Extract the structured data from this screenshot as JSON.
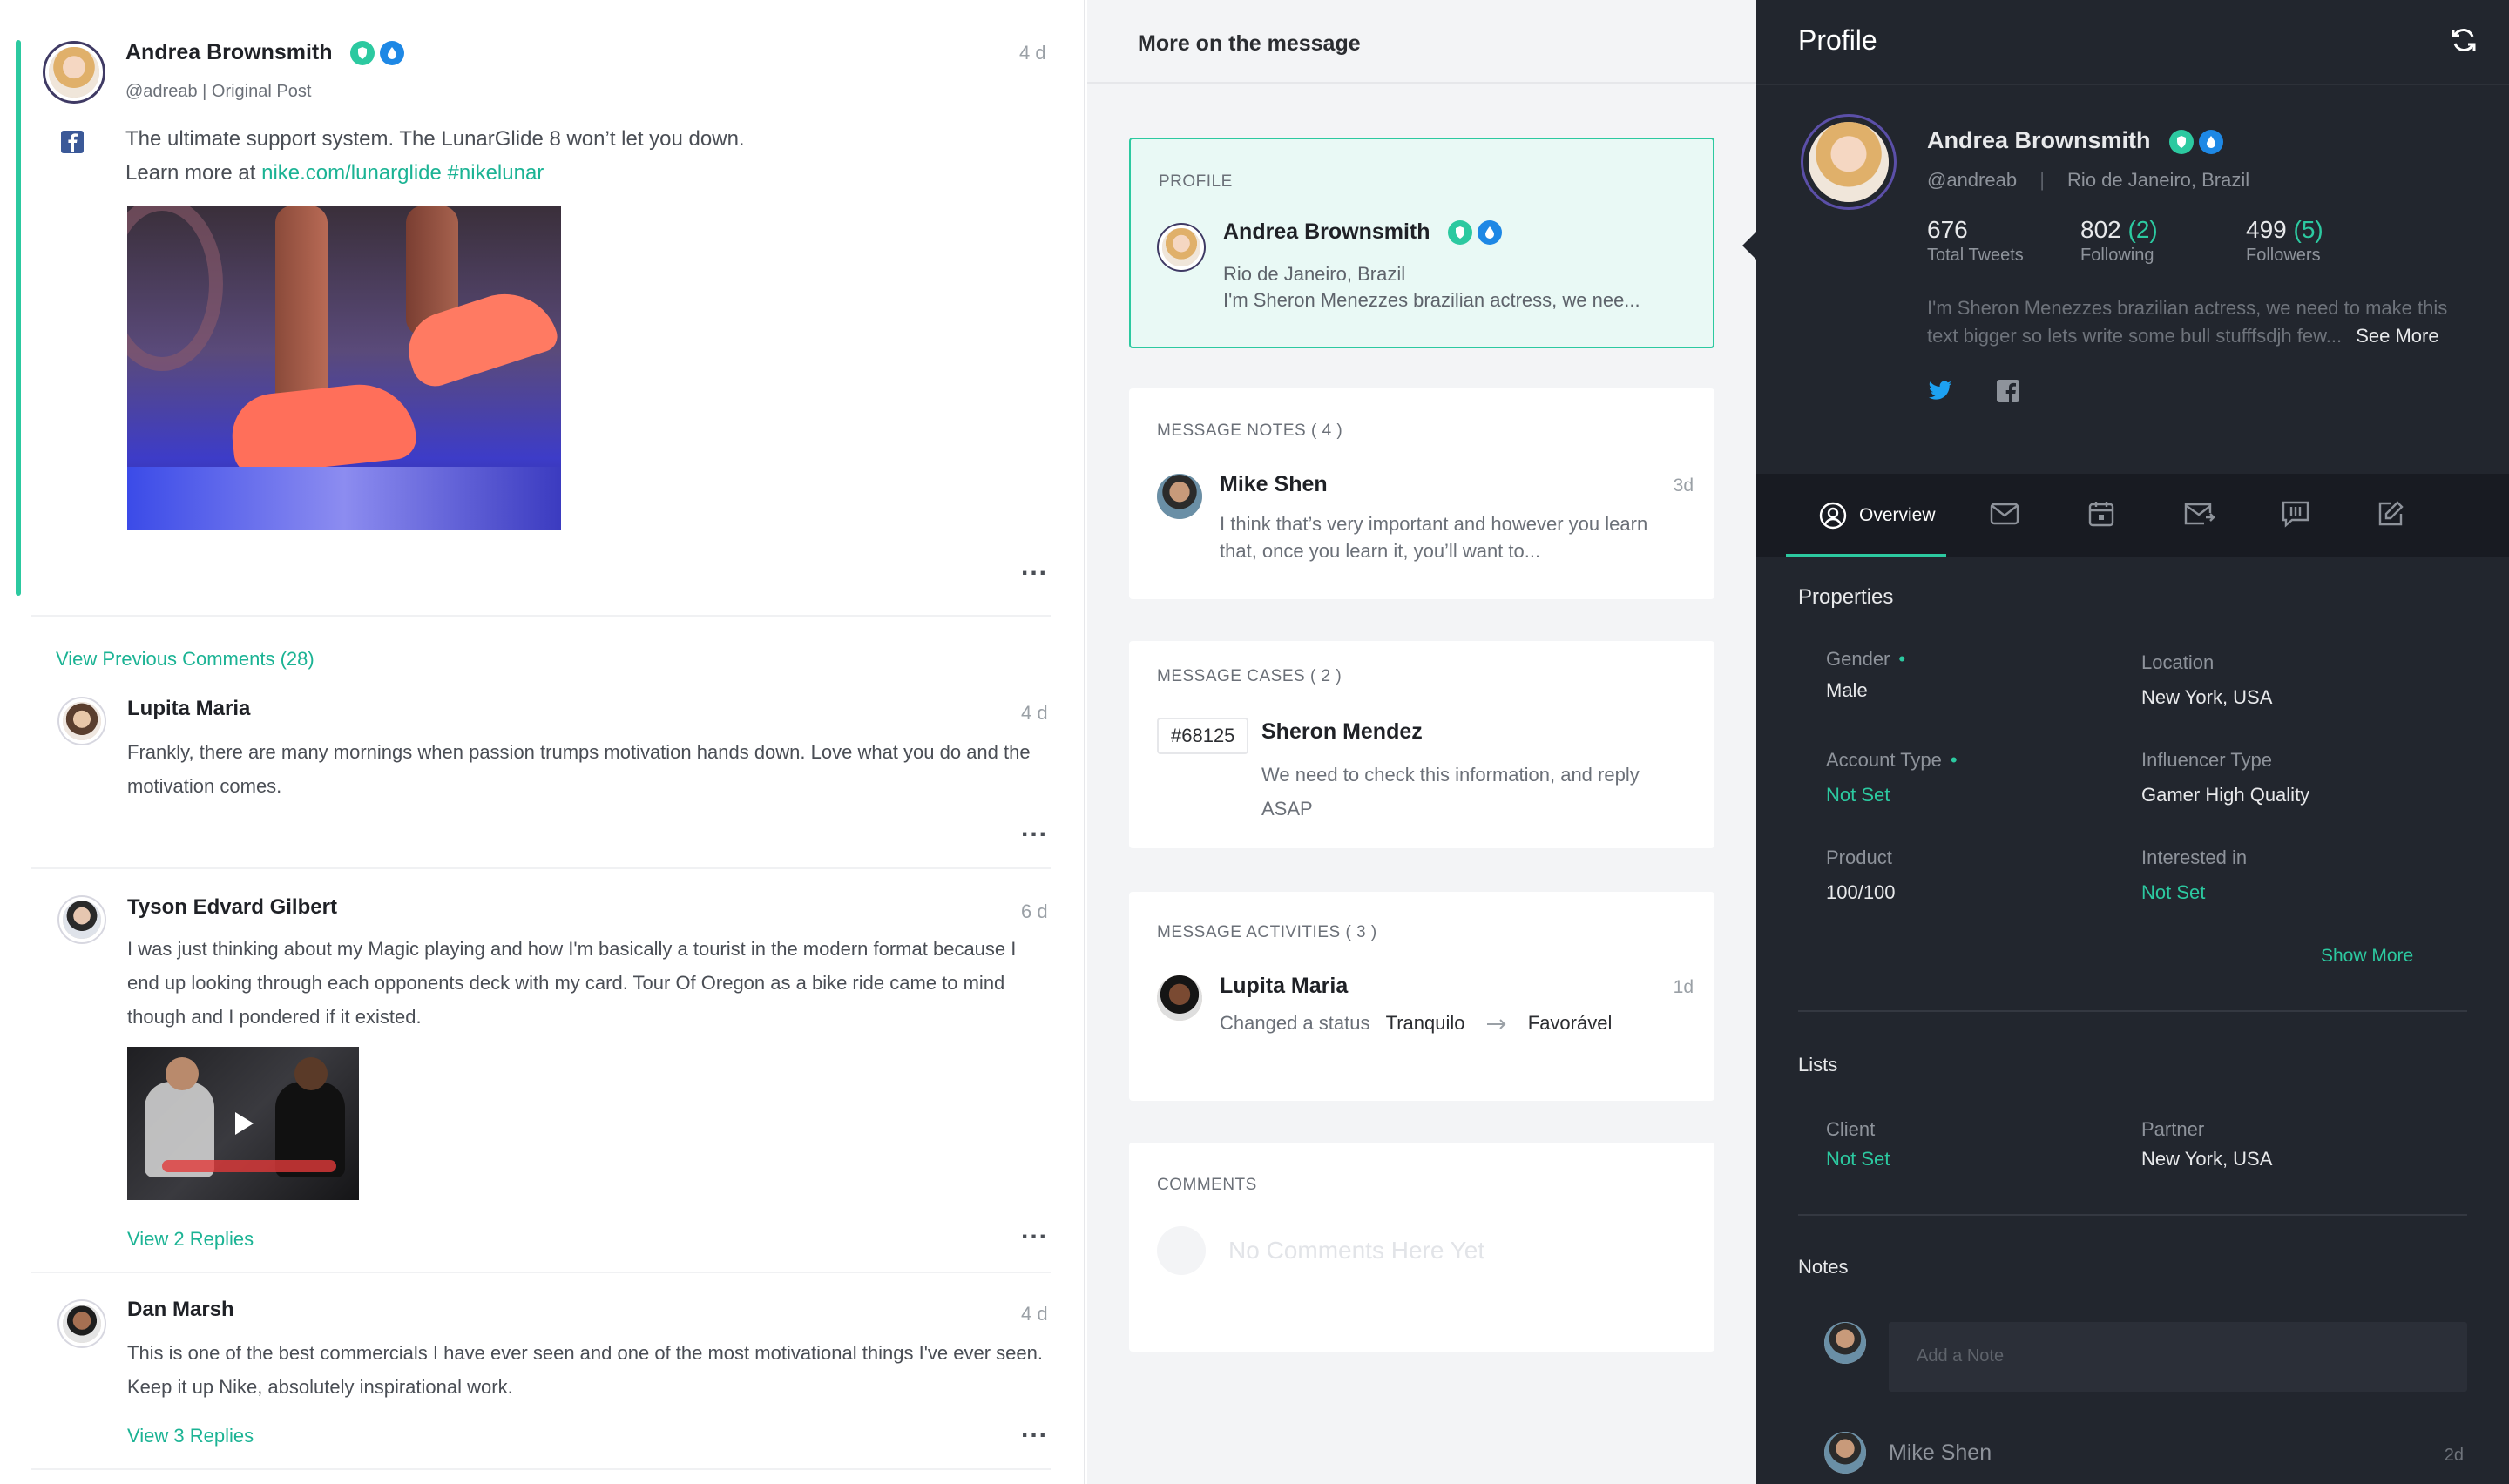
{
  "feed": {
    "original_post": {
      "author": "Andrea Brownsmith",
      "handle": "@adreab | Original Post",
      "time": "4 d",
      "text_line1": "The ultimate support system. The LunarGlide 8 won’t let you down.",
      "text_prefix": "Learn more at ",
      "link": "nike.com/lunarglide",
      "hashtag": "#nikelunar",
      "more": "..."
    },
    "view_previous": "View Previous Comments (28)",
    "comments": [
      {
        "author": "Lupita Maria",
        "time": "4 d",
        "text": "Frankly, there are many mornings when passion trumps motivation hands down. Love what you do and the motivation comes.",
        "more": "..."
      },
      {
        "author": "Tyson Edvard Gilbert",
        "time": "6 d",
        "text": "I was just thinking about my Magic playing and how I'm basically a tourist in the modern format because I end up looking through each opponents deck with my card. Tour Of Oregon as a bike ride came to mind though and I pondered if it existed.",
        "replies": "View 2 Replies",
        "more": "..."
      },
      {
        "author": "Dan Marsh",
        "time": "4 d",
        "text": "This is one of the best commercials I have ever seen and one of the most motivational things I've ever seen. Keep it up Nike, absolutely inspirational work.",
        "replies": "View 3 Replies",
        "more": "..."
      }
    ]
  },
  "middle": {
    "header": "More on the message",
    "profile_card": {
      "label": "PROFILE",
      "name": "Andrea Brownsmith",
      "location": "Rio de Janeiro, Brazil",
      "bio": "I'm Sheron Menezzes  brazilian actress, we nee..."
    },
    "notes_card": {
      "label": "MESSAGE NOTES ( 4 )",
      "author": "Mike Shen",
      "time": "3d",
      "text": "I think that’s very important and however you learn that, once you learn it, you’ll want to..."
    },
    "cases_card": {
      "label": "MESSAGE CASES ( 2 )",
      "case_id": "#68125",
      "name": "Sheron Mendez",
      "text": "We need to check this information, and reply ASAP"
    },
    "activities_card": {
      "label": "MESSAGE ACTIVITIES ( 3 )",
      "author": "Lupita Maria",
      "time": "1d",
      "action": "Changed a status",
      "from": "Tranquilo",
      "to": "Favorável"
    },
    "comments_card": {
      "label": "COMMENTS",
      "empty": "No Comments Here Yet"
    }
  },
  "profile": {
    "title": "Profile",
    "name": "Andrea Brownsmith",
    "handle": "@andreab",
    "location": "Rio de Janeiro, Brazil",
    "stats": [
      {
        "value": "676",
        "delta": "",
        "label": "Total Tweets"
      },
      {
        "value": "802",
        "delta": "(2)",
        "label": "Following"
      },
      {
        "value": "499",
        "delta": "(5)",
        "label": "Followers"
      }
    ],
    "bio_line1": "I'm Sheron Menezzes  brazilian actress, we need to make this",
    "bio_line2": "text bigger so lets write some bull stufffsdjh few...",
    "see_more": "See More",
    "tabs": {
      "overview": "Overview"
    },
    "properties_title": "Properties",
    "properties": [
      {
        "label": "Gender",
        "value": "Male",
        "required": true
      },
      {
        "label": "Location",
        "value": "New York, USA"
      },
      {
        "label": "Account Type",
        "value": "Not Set",
        "required": true
      },
      {
        "label": "Influencer Type",
        "value": "Gamer High Quality"
      },
      {
        "label": "Product",
        "value": "100/100"
      },
      {
        "label": "Interested in",
        "value": "Not Set"
      }
    ],
    "show_more": "Show More",
    "lists_title": "Lists",
    "lists": [
      {
        "label": "Client",
        "value": "Not Set"
      },
      {
        "label": "Partner",
        "value": "New York, USA"
      }
    ],
    "notes_title": "Notes",
    "note_placeholder": "Add a Note",
    "note_author": "Mike Shen",
    "note_time": "2d",
    "colors": {
      "accent": "#2cc9a0",
      "panel": "#22262e",
      "verified_blue": "#1e88e5"
    }
  }
}
